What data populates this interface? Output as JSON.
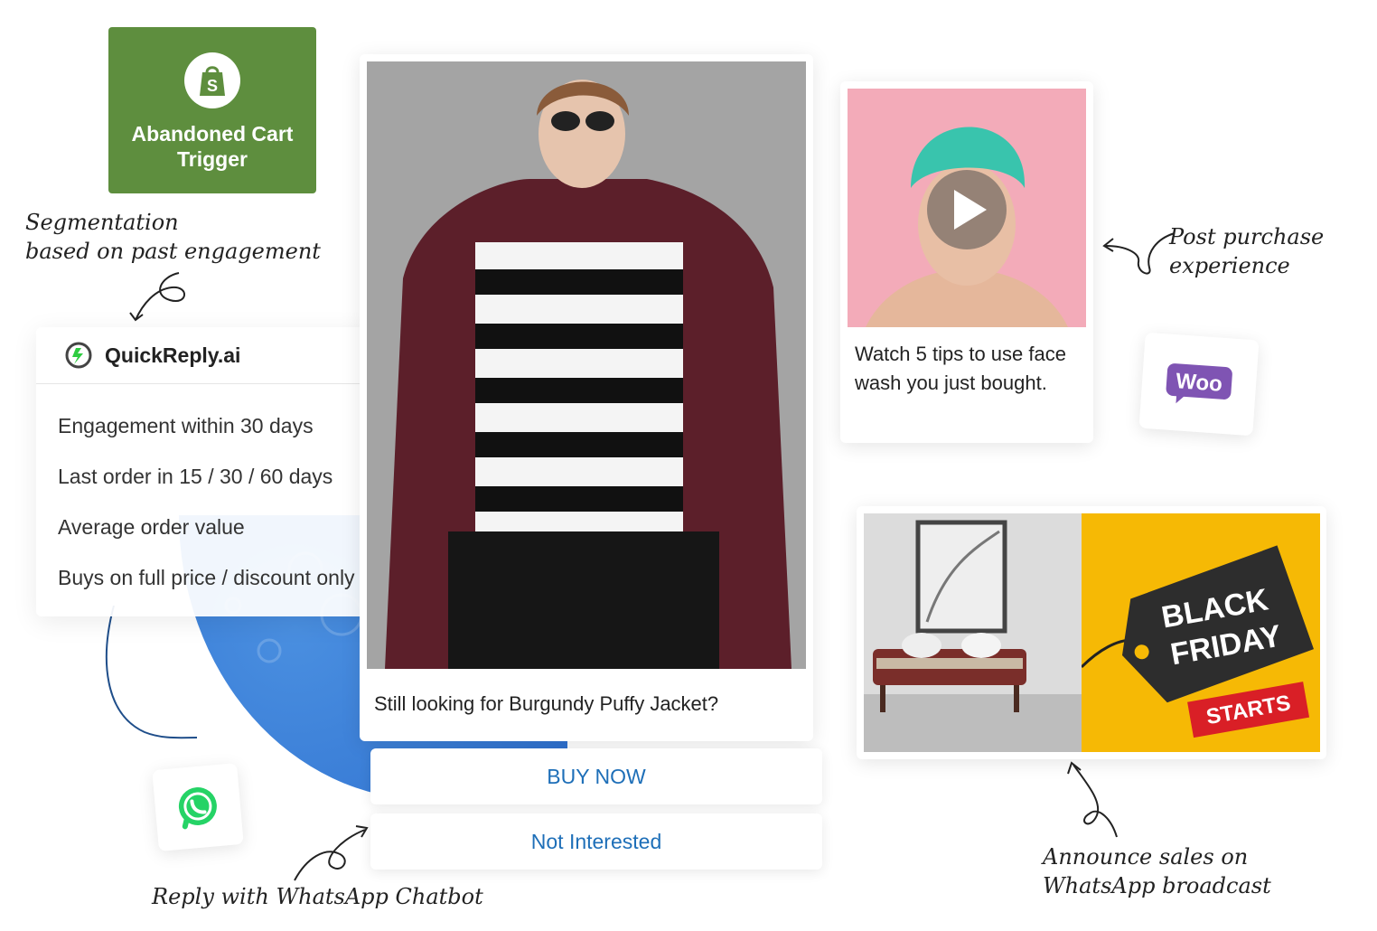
{
  "trigger": {
    "title": "Abandoned Cart Trigger",
    "icon": "shopify-bag-icon",
    "color": "#5e8e3e"
  },
  "notes": {
    "segmentation_line1": "Segmentation",
    "segmentation_line2": "based on past engagement",
    "post_purchase_line1": "Post purchase",
    "post_purchase_line2": "experience",
    "announce_line1": "Announce sales on",
    "announce_line2": "WhatsApp broadcast",
    "reply": "Reply with WhatsApp Chatbot"
  },
  "segment_card": {
    "brand": "QuickReply.ai",
    "items": [
      "Engagement within 30 days",
      "Last order in 15 / 30 / 60 days",
      "Average order value",
      "Buys on full price / discount only"
    ]
  },
  "product_message": {
    "caption": "Still looking for Burgundy Puffy Jacket?",
    "buttons": {
      "primary": "BUY NOW",
      "secondary": "Not Interested"
    },
    "button_color": "#1e6fb8"
  },
  "video_message": {
    "caption": "Watch 5 tips to use face wash you just bought.",
    "icon": "play-icon"
  },
  "woo_badge": {
    "label": "Woo",
    "color": "#7f54b3"
  },
  "sale_banner": {
    "line1": "BLACK",
    "line2": "FRIDAY",
    "tag": "STARTS"
  }
}
